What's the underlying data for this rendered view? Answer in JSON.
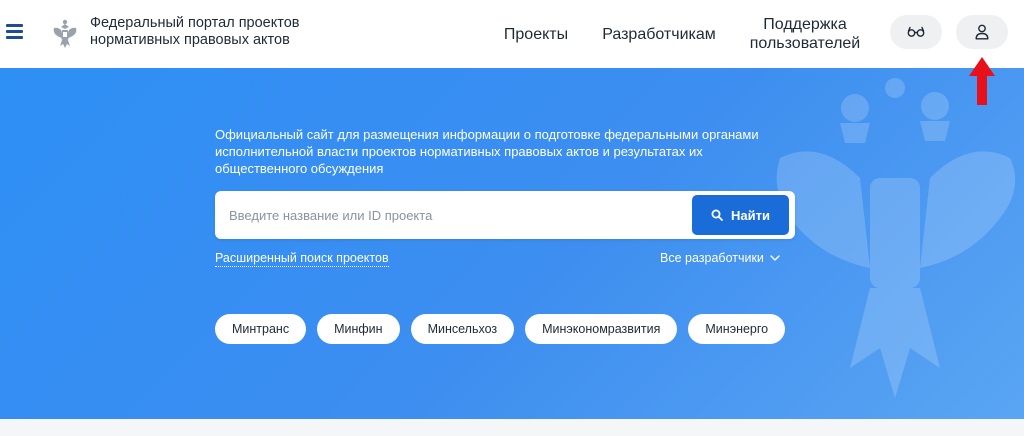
{
  "header": {
    "portal_title_line1": "Федеральный портал проектов",
    "portal_title_line2": "нормативных правовых актов",
    "nav": {
      "projects": "Проекты",
      "developers": "Разработчикам",
      "support_line1": "Поддержка",
      "support_line2": "пользователей"
    },
    "icons": {
      "menu": "menu-icon",
      "emblem": "emblem-icon",
      "vision": "glasses-icon",
      "user": "user-icon"
    }
  },
  "hero": {
    "description_line1": "Официальный сайт для размещения информации о подготовке федеральными органами",
    "description_line2": "исполнительной власти проектов нормативных правовых актов и результатах их",
    "description_line3": "общественного обсуждения",
    "search": {
      "placeholder": "Введите название или ID проекта",
      "value": "",
      "button_label": "Найти"
    },
    "advanced_search": "Расширенный поиск проектов",
    "all_developers": "Все разработчики",
    "chips": [
      "Минтранс",
      "Минфин",
      "Минсельхоз",
      "Минэкономразвития",
      "Минэнерго"
    ]
  },
  "colors": {
    "hero_blue": "#3d8ef0",
    "button_blue": "#1a6dd8",
    "arrow_red": "#e8101a"
  }
}
